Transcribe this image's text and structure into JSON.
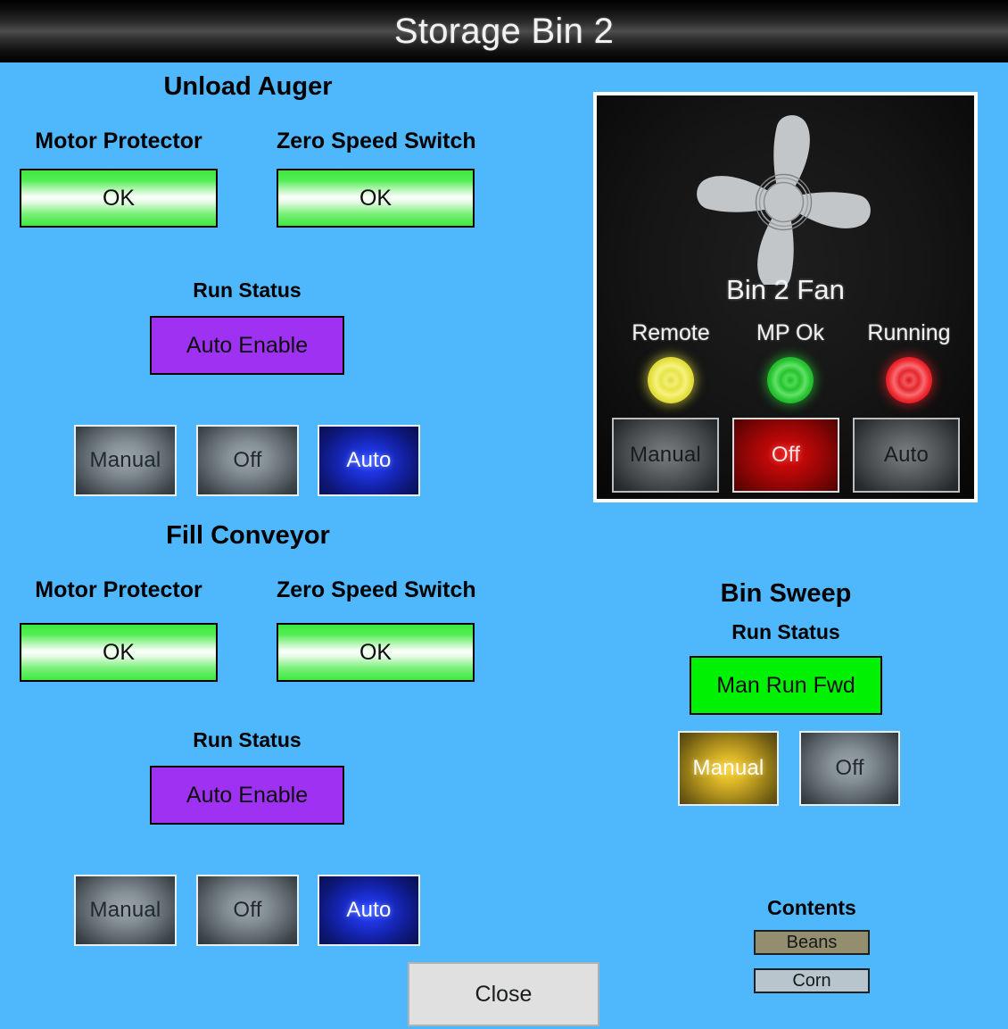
{
  "window": {
    "title": "Storage Bin 2",
    "background_color": "#4fb7fb"
  },
  "unload_auger": {
    "title": "Unload Auger",
    "motor_protector": {
      "label": "Motor Protector",
      "status": "OK",
      "color": "#3ce93c"
    },
    "zero_speed_switch": {
      "label": "Zero Speed Switch",
      "status": "OK",
      "color": "#3ce93c"
    },
    "run_status": {
      "label": "Run Status",
      "value": "Auto Enable",
      "color": "#9f31f2"
    },
    "modes": [
      {
        "label": "Manual",
        "state": "inactive"
      },
      {
        "label": "Off",
        "state": "inactive"
      },
      {
        "label": "Auto",
        "state": "active",
        "color": "#1f34e0"
      }
    ]
  },
  "fill_conveyor": {
    "title": "Fill Conveyor",
    "motor_protector": {
      "label": "Motor Protector",
      "status": "OK",
      "color": "#3ce93c"
    },
    "zero_speed_switch": {
      "label": "Zero Speed Switch",
      "status": "OK",
      "color": "#3ce93c"
    },
    "run_status": {
      "label": "Run Status",
      "value": "Auto Enable",
      "color": "#9f31f2"
    },
    "modes": [
      {
        "label": "Manual",
        "state": "inactive"
      },
      {
        "label": "Off",
        "state": "inactive"
      },
      {
        "label": "Auto",
        "state": "active",
        "color": "#1f34e0"
      }
    ]
  },
  "fan_panel": {
    "name": "Bin 2 Fan",
    "indicators": [
      {
        "label": "Remote",
        "color": "#e8e34a",
        "state": "on"
      },
      {
        "label": "MP Ok",
        "color": "#27c22f",
        "state": "on"
      },
      {
        "label": "Running",
        "color": "#e5272f",
        "state": "on"
      }
    ],
    "modes": [
      {
        "label": "Manual",
        "state": "inactive"
      },
      {
        "label": "Off",
        "state": "active",
        "color": "#c00808"
      },
      {
        "label": "Auto",
        "state": "inactive"
      }
    ]
  },
  "bin_sweep": {
    "title": "Bin Sweep",
    "run_status": {
      "label": "Run Status",
      "value": "Man Run Fwd",
      "color": "#00f203"
    },
    "modes": [
      {
        "label": "Manual",
        "state": "active",
        "color": "#ddb829"
      },
      {
        "label": "Off",
        "state": "inactive"
      }
    ]
  },
  "contents": {
    "title": "Contents",
    "items": [
      {
        "label": "Beans",
        "color": "#928e6e"
      },
      {
        "label": "Corn",
        "color": "#b9c5cd"
      }
    ]
  },
  "footer": {
    "close_label": "Close"
  }
}
